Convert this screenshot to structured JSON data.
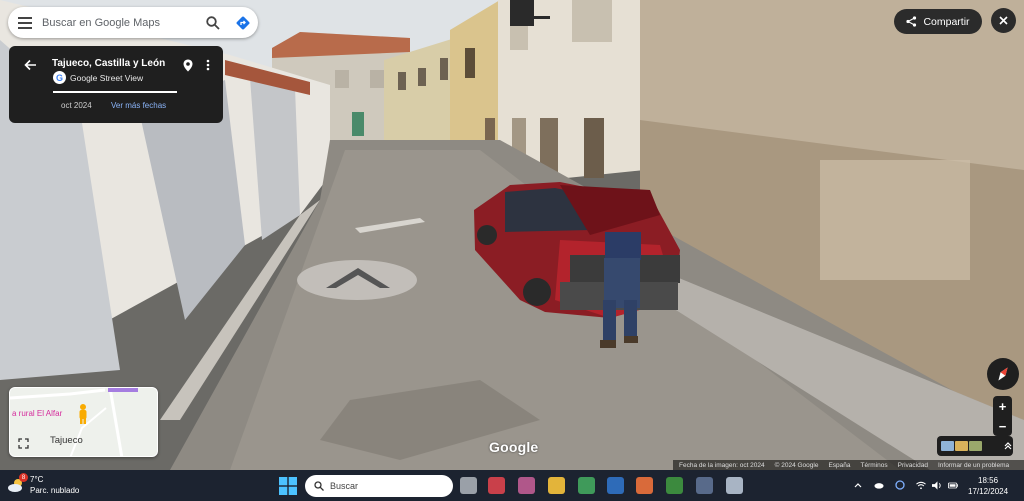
{
  "search": {
    "placeholder": "Buscar en Google Maps"
  },
  "location_card": {
    "title": "Tajueco, Castilla y León",
    "subtitle": "Google Street View",
    "date": "oct 2024",
    "more_dates_label": "Ver más fechas"
  },
  "share_label": "Compartir",
  "minimap": {
    "poi_label": "a rural El Alfar",
    "town_label": "Tajueco"
  },
  "watermark": "Google",
  "footer": {
    "image_date": "Fecha de la imagen: oct 2024",
    "copyright": "© 2024 Google",
    "links": [
      "España",
      "Términos",
      "Privacidad",
      "Informar de un problema"
    ]
  },
  "taskbar": {
    "weather_temp": "7°C",
    "weather_desc": "Parc. nublado",
    "notification_count": "8",
    "search_placeholder": "Buscar",
    "clock_time": "18:56",
    "clock_date": "17/12/2024"
  },
  "colors": {
    "card_bg": "#1f1f1f",
    "link": "#8ab4f8",
    "taskbar_bg": "#1c2330",
    "poi_pink": "#d42c9c"
  }
}
